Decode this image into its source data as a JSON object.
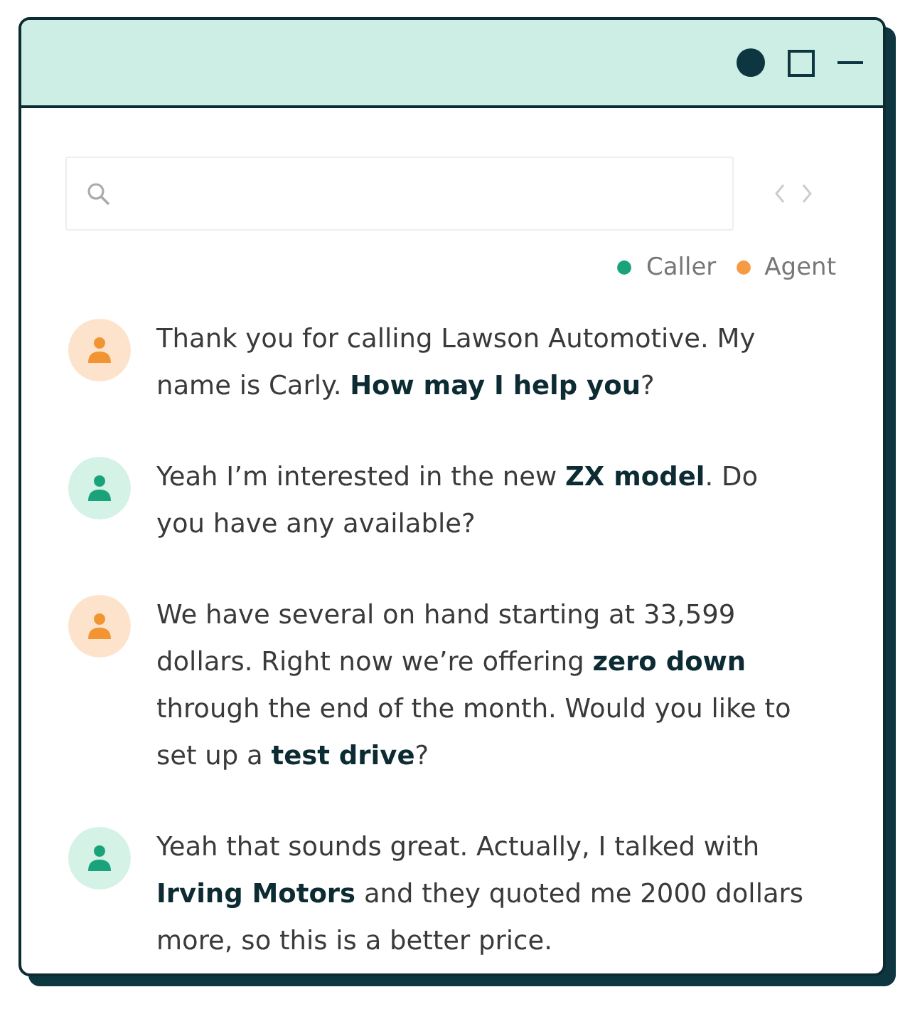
{
  "legend": [
    {
      "label": "Caller",
      "color": "#1aa37a"
    },
    {
      "label": "Agent",
      "color": "#f59b42"
    }
  ],
  "messages": [
    {
      "kind": "agent",
      "text": "Thank you for calling Lawson Automotive. My name is Carly. **How may I help you**?"
    },
    {
      "kind": "caller",
      "text": "Yeah I’m interested in the new **ZX model**. Do you have any available?"
    },
    {
      "kind": "agent",
      "text": "We have several on hand starting at 33,599 dollars. Right now we’re offering **zero down** through the end of the month. Would you like to set up a **test drive**?"
    },
    {
      "kind": "caller",
      "text": "Yeah that sounds great. Actually, I talked with **Irving Motors** and they quoted me 2000 dollars more, so this is a better price."
    }
  ]
}
